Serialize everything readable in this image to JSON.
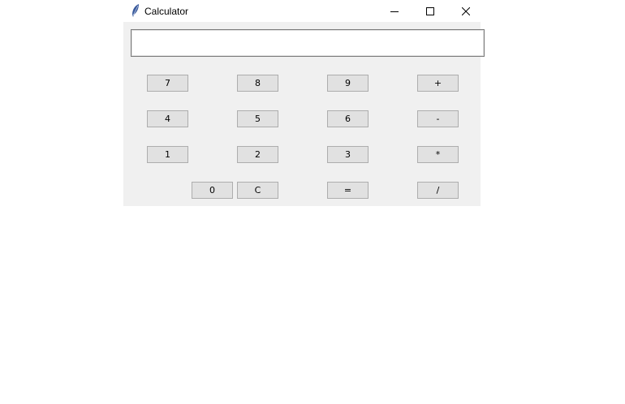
{
  "window": {
    "title": "Calculator"
  },
  "display": {
    "value": ""
  },
  "keypad": {
    "row1": [
      "7",
      "8",
      "9",
      "+"
    ],
    "row2": [
      "4",
      "5",
      "6",
      "-"
    ],
    "row3": [
      "1",
      "2",
      "3",
      "*"
    ],
    "row4": [
      "0",
      "C",
      "=",
      "/"
    ]
  },
  "icons": {
    "app": "feather-icon",
    "minimize": "minimize-icon",
    "maximize": "maximize-icon",
    "close": "close-icon"
  },
  "colors": {
    "window_bg": "#f0f0f0",
    "button_bg": "#e1e1e1",
    "button_border": "#adadad",
    "feather": "#3a5a9c"
  }
}
